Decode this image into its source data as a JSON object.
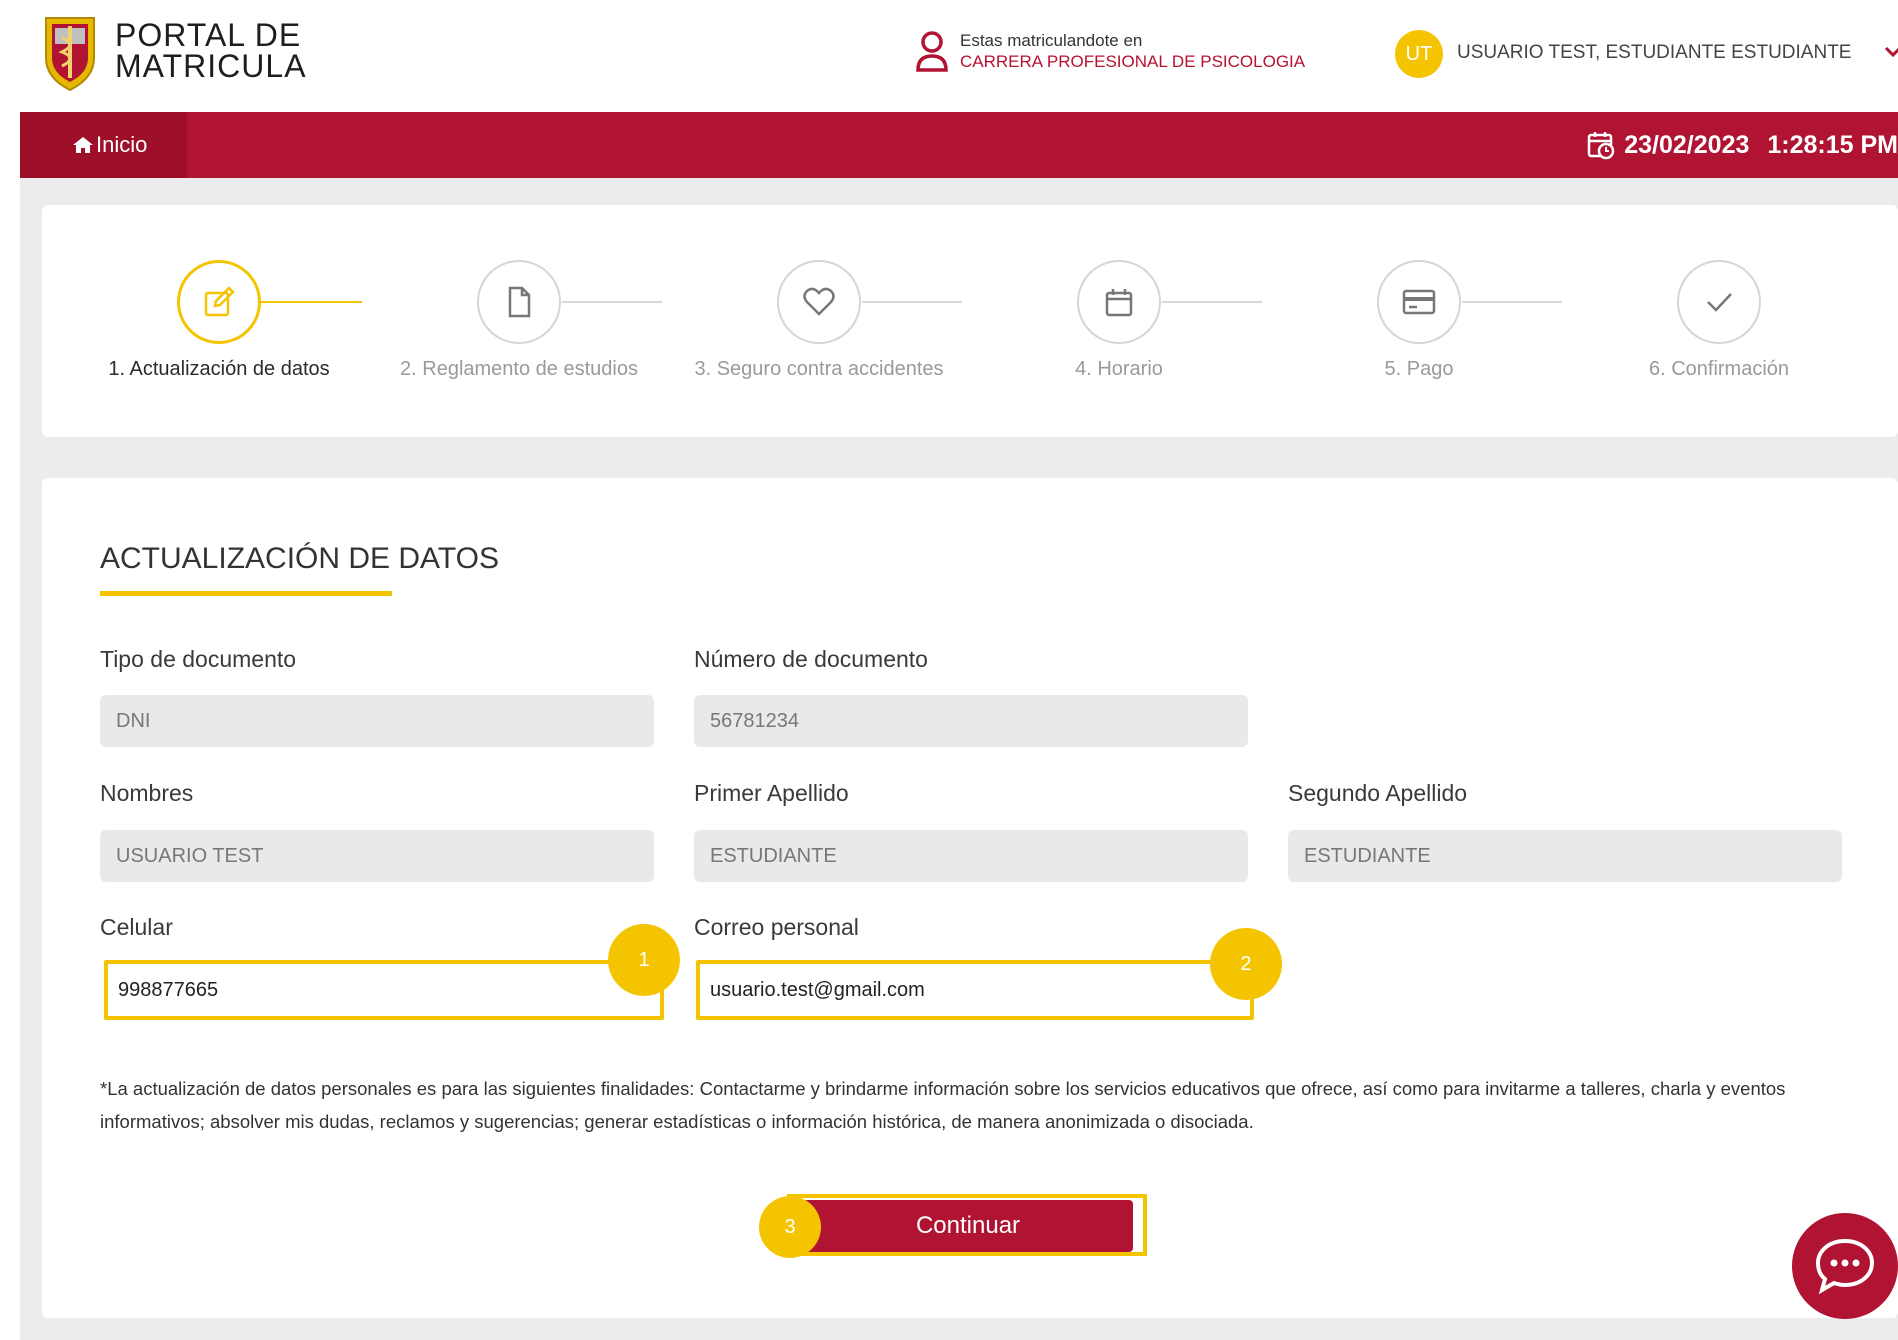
{
  "header": {
    "brand_line1": "PORTAL DE",
    "brand_line2": "MATRICULA",
    "enrolling_label": "Estas matriculandote en",
    "enrolling_program": "CARRERA PROFESIONAL DE PSICOLOGIA",
    "user_initials": "UT",
    "user_name": "USUARIO TEST, ESTUDIANTE ESTUDIANTE"
  },
  "nav": {
    "home_label": "Inicio",
    "date": "23/02/2023",
    "time": "1:28:15 PM"
  },
  "stepper": {
    "steps": [
      {
        "label": "1. Actualización de datos",
        "icon": "edit-icon",
        "active": true
      },
      {
        "label": "2. Reglamento de estudios",
        "icon": "document-icon",
        "active": false
      },
      {
        "label": "3. Seguro contra accidentes",
        "icon": "heart-icon",
        "active": false
      },
      {
        "label": "4. Horario",
        "icon": "calendar-icon",
        "active": false
      },
      {
        "label": "5. Pago",
        "icon": "credit-card-icon",
        "active": false
      },
      {
        "label": "6. Confirmación",
        "icon": "check-icon",
        "active": false
      }
    ]
  },
  "form": {
    "title": "ACTUALIZACIÓN DE DATOS",
    "tipo_documento": {
      "label": "Tipo de documento",
      "value": "DNI"
    },
    "numero_documento": {
      "label": "Número de documento",
      "value": "56781234"
    },
    "nombres": {
      "label": "Nombres",
      "value": "USUARIO TEST"
    },
    "primer_apellido": {
      "label": "Primer Apellido",
      "value": "ESTUDIANTE"
    },
    "segundo_apellido": {
      "label": "Segundo Apellido",
      "value": "ESTUDIANTE"
    },
    "celular": {
      "label": "Celular",
      "value": "998877665",
      "badge": "1"
    },
    "correo": {
      "label": "Correo personal",
      "value": "usuario.test@gmail.com",
      "badge": "2"
    },
    "note": "*La actualización de datos personales es para las siguientes finalidades: Contactarme y brindarme información sobre los servicios educativos que ofrece, así como para invitarme a talleres, charla y eventos informativos; absolver mis dudas, reclamos y sugerencias; generar estadísticas o información histórica, de manera anonimizada o disociada.",
    "continue_label": "Continuar",
    "continue_badge": "3"
  },
  "colors": {
    "brand_red": "#b01432",
    "accent_yellow": "#f5c400",
    "page_bg": "#ececee"
  },
  "chat": {
    "icon": "chat-bubble-icon"
  }
}
